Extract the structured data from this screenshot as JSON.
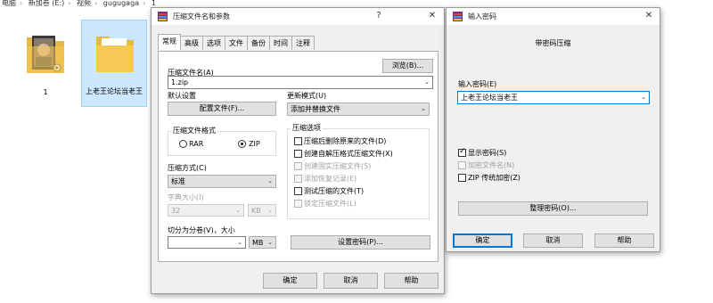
{
  "explorer": {
    "breadcrumb": [
      "电脑",
      "新加卷 (E:)",
      "视频",
      "gugugaga",
      "1"
    ],
    "folders": [
      {
        "label": "1"
      },
      {
        "label": "上老王论坛当老王"
      }
    ]
  },
  "archive_dialog": {
    "title": "压缩文件名和参数",
    "help_glyph": "?",
    "close_glyph": "✕",
    "tabs": [
      "常规",
      "高级",
      "选项",
      "文件",
      "备份",
      "时间",
      "注释"
    ],
    "archive_name_label": "压缩文件名(A)",
    "archive_name_value": "1.zip",
    "browse_button": "浏览(B)...",
    "default_settings_label": "默认设置",
    "profiles_button": "配置文件(F)...",
    "update_mode_label": "更新模式(U)",
    "update_mode_value": "添加并替换文件",
    "format_group_title": "压缩文件格式",
    "format_rar": "RAR",
    "format_zip": "ZIP",
    "method_label": "压缩方式(C)",
    "method_value": "标准",
    "dict_label": "字典大小(I)",
    "dict_value": "32",
    "dict_unit": "KB",
    "split_label": "切分为分卷(V)，大小",
    "split_unit": "MB",
    "options_group_title": "压缩选项",
    "options": [
      {
        "label": "压缩后删除原来的文件(D)",
        "checked": false,
        "enabled": true
      },
      {
        "label": "创建自解压格式压缩文件(X)",
        "checked": false,
        "enabled": true
      },
      {
        "label": "创建固实压缩文件(S)",
        "checked": false,
        "enabled": false
      },
      {
        "label": "添加恢复记录(E)",
        "checked": false,
        "enabled": false
      },
      {
        "label": "测试压缩的文件(T)",
        "checked": false,
        "enabled": true
      },
      {
        "label": "锁定压缩文件(L)",
        "checked": false,
        "enabled": false
      }
    ],
    "set_password_button": "设置密码(P)...",
    "ok_button": "确定",
    "cancel_button": "取消",
    "help_button": "帮助"
  },
  "password_dialog": {
    "title": "输入密码",
    "close_glyph": "✕",
    "heading": "带密码压缩",
    "password_label": "输入密码(E)",
    "password_value": "上老王论坛当老王",
    "show_password": "显示密码(S)",
    "encrypt_names": "加密文件名(N)",
    "zip_legacy": "ZIP 传统加密(Z)",
    "organize_button": "整理密码(O)...",
    "ok_button": "确定",
    "cancel_button": "取消",
    "help_button": "帮助"
  },
  "colors": {
    "selection_bg": "#cce8ff",
    "folder_yellow": "#f5c954",
    "dialog_bg": "#f0f0f0",
    "focus_blue": "#0078d7"
  }
}
